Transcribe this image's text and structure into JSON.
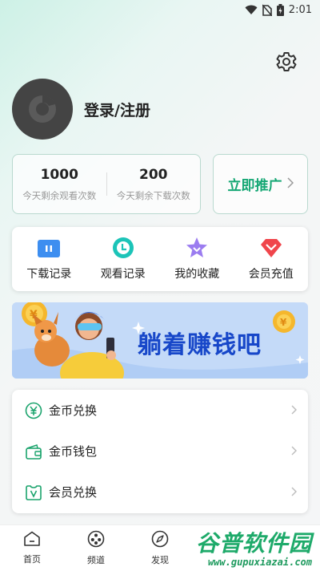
{
  "status_bar": {
    "time": "2:01"
  },
  "profile": {
    "login_label": "登录/注册"
  },
  "stats": [
    {
      "value": "1000",
      "label": "今天剩余观看次数"
    },
    {
      "value": "200",
      "label": "今天剩余下载次数"
    }
  ],
  "promote": {
    "label": "立即推广"
  },
  "quick_actions": [
    {
      "label": "下载记录",
      "icon": "download-record-icon"
    },
    {
      "label": "观看记录",
      "icon": "watch-history-icon"
    },
    {
      "label": "我的收藏",
      "icon": "favorites-icon"
    },
    {
      "label": "会员充值",
      "icon": "vip-recharge-icon"
    }
  ],
  "banner": {
    "text": "躺着赚钱吧"
  },
  "menu": [
    {
      "label": "金币兑换",
      "icon": "coin-exchange-icon"
    },
    {
      "label": "金币钱包",
      "icon": "coin-wallet-icon"
    },
    {
      "label": "会员兑换",
      "icon": "vip-exchange-icon"
    }
  ],
  "bottom_nav": [
    {
      "label": "首页",
      "icon": "home-icon"
    },
    {
      "label": "频道",
      "icon": "channel-icon"
    },
    {
      "label": "发现",
      "icon": "discover-icon"
    }
  ],
  "watermark": {
    "title": "谷普软件园",
    "url": "www.gupuxiazai.com"
  },
  "colors": {
    "accent": "#15a774",
    "banner_text": "#1747c9"
  }
}
